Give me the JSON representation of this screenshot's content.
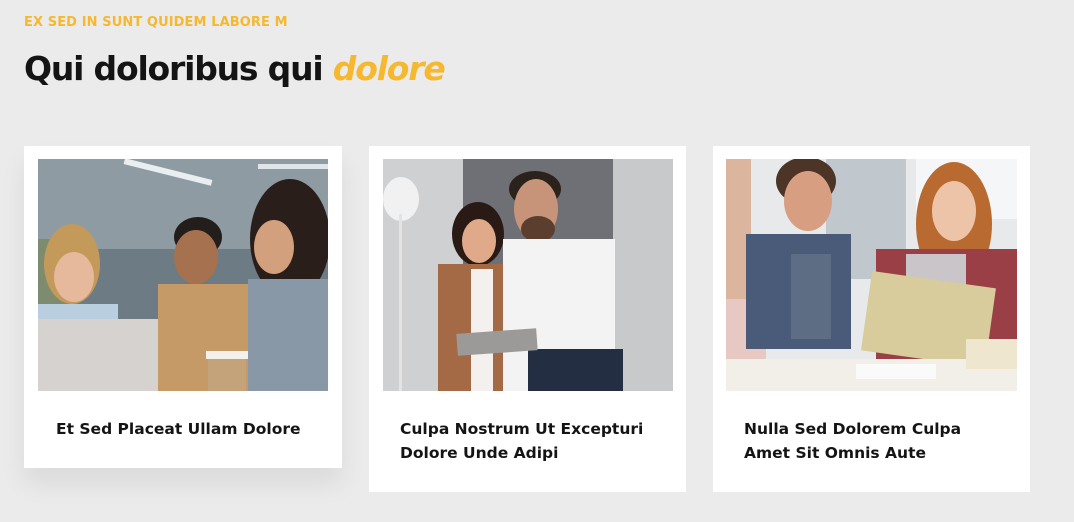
{
  "section": {
    "eyebrow": "EX SED IN SUNT QUIDEM LABORE M",
    "heading_main": "Qui doloribus qui",
    "heading_accent": "dolore"
  },
  "cards": [
    {
      "title": "Et Sed Placeat Ullam Dolore"
    },
    {
      "title": "Culpa Nostrum Ut Excepturi Dolore Unde Adipi"
    },
    {
      "title": "Nulla Sed Dolorem Culpa Amet Sit Omnis Aute"
    }
  ],
  "colors": {
    "accent": "#f5b82e",
    "background": "#ebebeb",
    "card": "#ffffff",
    "text": "#141414"
  }
}
